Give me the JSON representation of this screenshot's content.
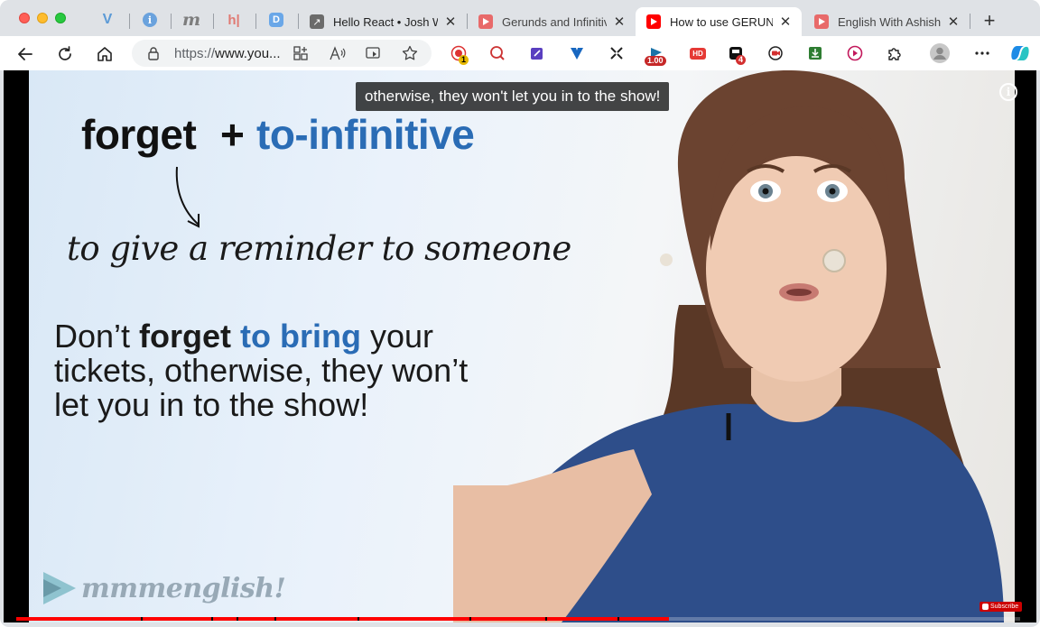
{
  "colors": {
    "accent_blue": "#2a6cb5",
    "youtube_red": "#ff0000",
    "tab_strip": "#dfe2e6"
  },
  "pinned_tabs": [
    {
      "icon": "vuetify-logo-icon",
      "label": "V"
    },
    {
      "icon": "info-page-icon",
      "label": "i"
    },
    {
      "icon": "medium-m-icon",
      "label": "m"
    },
    {
      "icon": "hashnode-h-icon",
      "label": "h|"
    },
    {
      "icon": "d-logo-icon",
      "label": "D"
    }
  ],
  "tabs": [
    {
      "title": "Hello React • Josh W",
      "icon": "arrow-square-icon",
      "active": false
    },
    {
      "title": "Gerunds and Infinitiv",
      "icon": "youtube-icon",
      "active": false
    },
    {
      "title": "How to use GERUNDS",
      "icon": "youtube-icon",
      "active": true
    },
    {
      "title": "English With Ashish -",
      "icon": "youtube-icon",
      "active": false
    }
  ],
  "toolbar": {
    "url_scheme": "https://",
    "url_host": "www.you...",
    "ext_badges": {
      "record": "1",
      "speed": "1.00",
      "hd": "HD",
      "count": "4"
    }
  },
  "video": {
    "caption": "otherwise, they won't let you in to the show!",
    "slide": {
      "heading_verb": "forget",
      "heading_plus": "+",
      "heading_form": "to-infinitive",
      "meaning": "to give a reminder to someone",
      "sentence_1a": "Don’t ",
      "sentence_1b": "forget",
      "sentence_1c": " to bring",
      "sentence_1d": " your",
      "sentence_2": "tickets, otherwise, they won’t",
      "sentence_3": "let you in to the show!"
    },
    "logo": "mmmenglish!",
    "subscribe_label": "Subscribe",
    "progress_fraction": 0.65
  }
}
